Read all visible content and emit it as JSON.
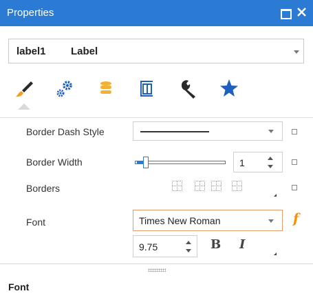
{
  "window": {
    "title": "Properties",
    "accent_color": "#2b7bd4",
    "buttons": [
      "maximize-icon",
      "close-icon"
    ]
  },
  "object_selector": {
    "name": "label1",
    "type": "Label"
  },
  "toolbar": {
    "active": "appearance",
    "tabs": [
      "brush-icon",
      "gears-icon",
      "database-icon",
      "layout-icon",
      "wrench-icon",
      "star-icon"
    ]
  },
  "properties": {
    "border_dash_style": {
      "label": "Border Dash Style",
      "value": "solid-line"
    },
    "border_width": {
      "label": "Border Width",
      "value": "1",
      "slider_fraction": 0.1
    },
    "borders": {
      "label": "Borders",
      "buttons": [
        "border-all-icon",
        "border-top-bottom-icon",
        "border-left-right-icon",
        "border-bottom-icon"
      ]
    },
    "font": {
      "label": "Font",
      "family": "Times New Roman",
      "size": "9.75",
      "bold_label": "B",
      "italic_label": "I",
      "expression_label": "f",
      "highlight_color": "#e39b6b",
      "expression_color": "#ff8c00"
    }
  },
  "description": {
    "title": "Font"
  }
}
